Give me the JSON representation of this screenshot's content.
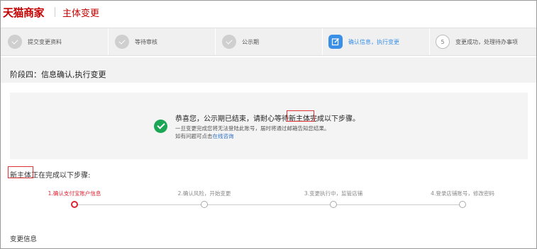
{
  "header": {
    "logo": "天猫商家",
    "title": "主体变更"
  },
  "steps": [
    {
      "label": "提交变更资料",
      "state": "done",
      "icon": "check-icon"
    },
    {
      "label": "等待审核",
      "state": "done",
      "icon": "check-icon"
    },
    {
      "label": "公示期",
      "state": "done",
      "icon": "check-icon"
    },
    {
      "label": "确认信息，执行变更",
      "state": "active",
      "icon": "edit-icon"
    },
    {
      "label": "变更成功，处理待办事项",
      "state": "todo",
      "number": "5"
    }
  ],
  "stage": {
    "title": "阶段四：信息确认,执行变更"
  },
  "notice": {
    "main": "恭喜您，公示期已结束，请耐心等待新主体完成以下步骤。",
    "line1": "一旦变更完成您将无法登陆此账号，届时将通过邮箱告知您结果。",
    "line2_prefix": "如有问题可点击",
    "line2_link": "在线咨询",
    "icon": "success-check-icon",
    "success_color": "#1aa655"
  },
  "progress": {
    "title": "新主体正在完成以下步骤:",
    "items": [
      {
        "label": "1.确认支付宝账户信息",
        "active": true
      },
      {
        "label": "2.确认风险，开始变更",
        "active": false
      },
      {
        "label": "3.变更执行中，监管店铺",
        "active": false
      },
      {
        "label": "4.登录店铺账号，修改密码",
        "active": false
      }
    ],
    "accent_color": "#dd2233"
  },
  "section": {
    "title": "变更信息"
  },
  "colors": {
    "brand": "#c40000",
    "active_step": "#3a8fe6",
    "link": "#2a6fc9"
  }
}
